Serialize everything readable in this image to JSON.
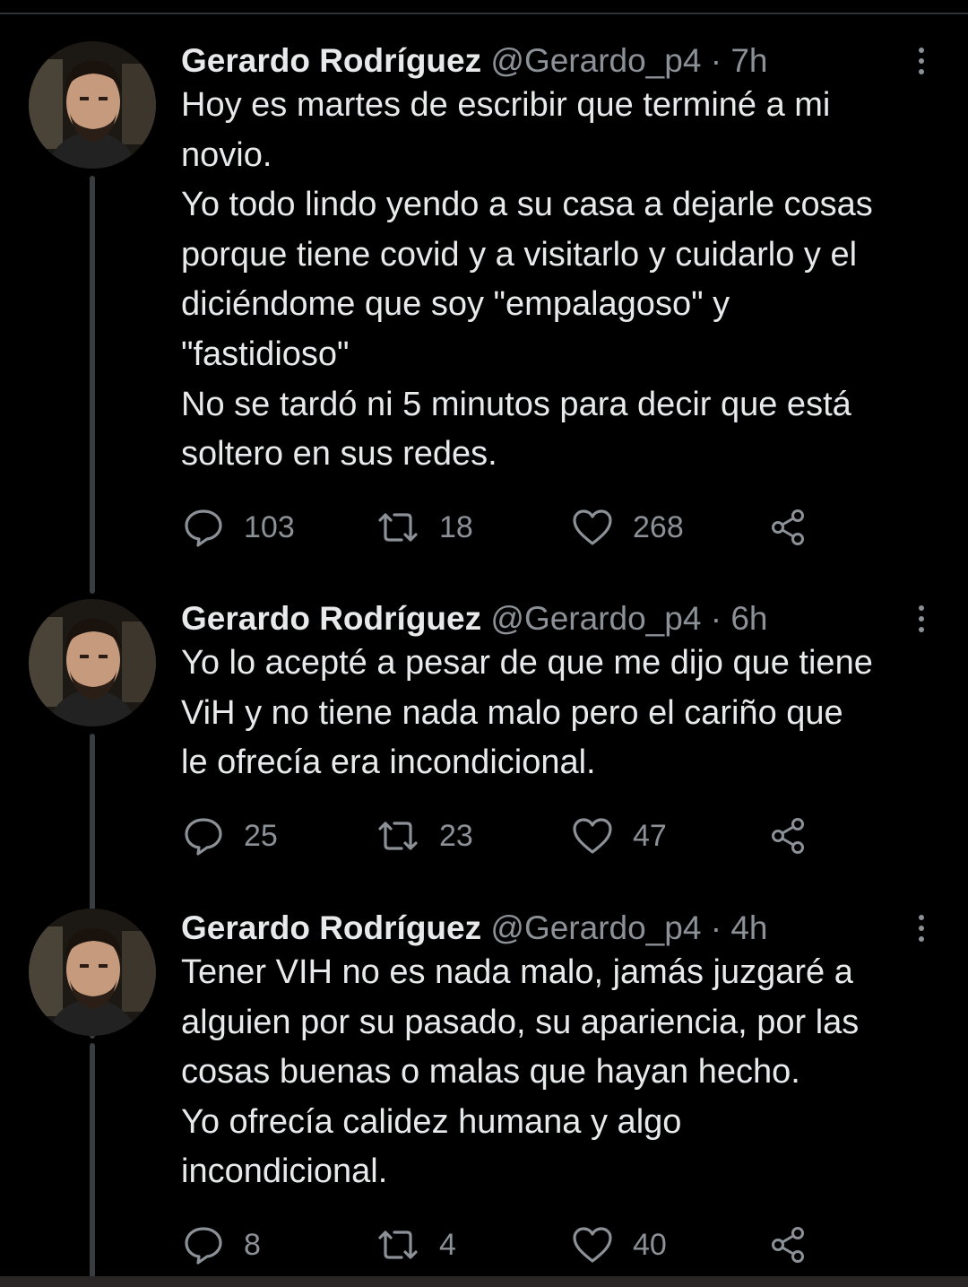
{
  "tweets": [
    {
      "name": "Gerardo Rodríguez",
      "handle": "@Gerardo_p4",
      "separator": "·",
      "time": "7h",
      "text": "Hoy es martes de escribir que terminé a mi\nnovio.\nYo todo lindo yendo a su casa a dejarle cosas\nporque tiene covid y a visitarlo y cuidarlo y el\ndiciéndome que soy \"empalagoso\" y\n\"fastidioso\"\nNo se tardó ni 5 minutos para decir que está\nsoltero en sus redes.",
      "replies": "103",
      "retweets": "18",
      "likes": "268"
    },
    {
      "name": "Gerardo Rodríguez",
      "handle": "@Gerardo_p4",
      "separator": "·",
      "time": "6h",
      "text": "Yo lo acepté a pesar de que me dijo que tiene\nViH y no tiene nada malo pero el cariño que\nle ofrecía era incondicional.",
      "replies": "25",
      "retweets": "23",
      "likes": "47"
    },
    {
      "name": "Gerardo Rodríguez",
      "handle": "@Gerardo_p4",
      "separator": "·",
      "time": "4h",
      "text": "Tener VIH no es nada malo, jamás juzgaré a\nalguien  por su pasado, su apariencia, por las\ncosas buenas o malas que hayan hecho.\nYo ofrecía calidez humana y algo\nincondicional.",
      "replies": "8",
      "retweets": "4",
      "likes": "40"
    }
  ],
  "icons": {
    "more": "more-vertical-icon",
    "reply": "reply-bubble-icon",
    "retweet": "retweet-icon",
    "like": "heart-icon",
    "share": "share-icon"
  },
  "colors": {
    "background": "#000000",
    "text": "#e7e9ea",
    "secondary": "#8b9196",
    "thread_line": "#3a3d40"
  }
}
